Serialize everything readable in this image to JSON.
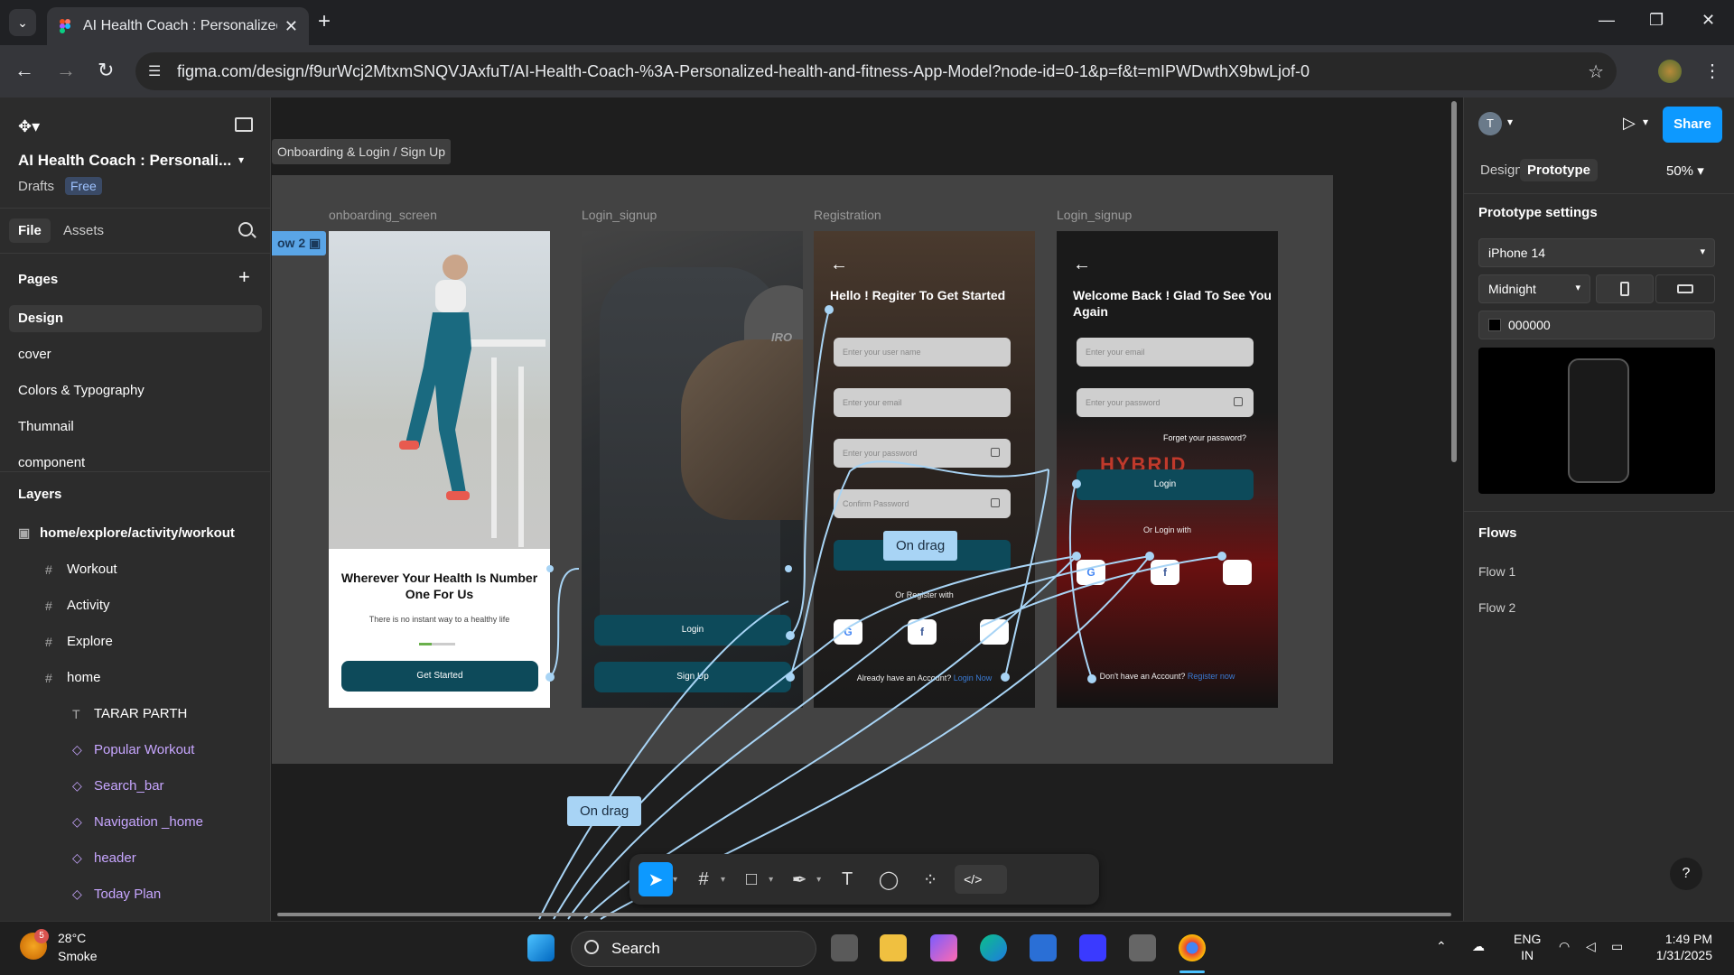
{
  "browser": {
    "tab_title": "AI Health Coach : Personalized",
    "url": "figma.com/design/f9urWcj2MtxmSNQVJAxfuT/AI-Health-Coach-%3A-Personalized-health-and-fitness-App-Model?node-id=0-1&p=f&t=mIPWDwthX9bwLjof-0"
  },
  "left": {
    "project_title": "AI Health Coach : Personali...",
    "drafts": "Drafts",
    "plan_badge": "Free",
    "tabs": [
      "File",
      "Assets"
    ],
    "pages_header": "Pages",
    "pages": [
      "Design",
      "cover",
      "Colors & Typography",
      "Thumnail",
      "component"
    ],
    "layers_header": "Layers",
    "layers": [
      {
        "name": "home/explore/activity/workout",
        "type": "section"
      },
      {
        "name": "Workout",
        "type": "frame"
      },
      {
        "name": "Activity",
        "type": "frame"
      },
      {
        "name": "Explore",
        "type": "frame"
      },
      {
        "name": "home",
        "type": "frame"
      },
      {
        "name": "TARAR PARTH",
        "type": "text"
      },
      {
        "name": "Popular Workout",
        "type": "component"
      },
      {
        "name": "Search_bar",
        "type": "component"
      },
      {
        "name": "Navigation _home",
        "type": "component"
      },
      {
        "name": "header",
        "type": "component"
      },
      {
        "name": "Today Plan",
        "type": "component"
      }
    ]
  },
  "canvas": {
    "section_label": "Onboarding & Login / Sign Up",
    "flow_tag": "ow 2",
    "frames": {
      "f1": {
        "label": "onboarding_screen",
        "title": "Wherever Your Health Is Number One For Us",
        "subtitle": "There is no instant way to a healthy life",
        "button": "Get Started"
      },
      "f2": {
        "label": "Login_signup",
        "login": "Login",
        "signup": "Sign Up",
        "brand": "IRO"
      },
      "f3": {
        "label": "Registration",
        "title": "Hello ! Regiter To Get Started",
        "username": "Enter your user name",
        "email": "Enter your email",
        "password": "Enter your password",
        "confirm": "Confirm Password",
        "or": "Or Register with",
        "footer": "Already have an Account?",
        "footer_link": "Login Now"
      },
      "f4": {
        "label": "Login_signup",
        "title": "Welcome Back ! Glad To See You Again",
        "email": "Enter your email",
        "password": "Enter your password",
        "forgot": "Forget your password?",
        "login": "Login",
        "or": "Or Login with",
        "footer": "Don't have an Account?",
        "footer_link": "Register now",
        "bg_text": "HYBRID"
      }
    },
    "ondrag_labels": [
      "On drag",
      "On drag"
    ]
  },
  "right": {
    "user_initial": "T",
    "share": "Share",
    "tabs": [
      "Design",
      "Prototype"
    ],
    "zoom": "50%",
    "proto_settings": "Prototype settings",
    "device": "iPhone 14",
    "model": "Midnight",
    "bg_hex": "000000",
    "flows_header": "Flows",
    "flows": [
      "Flow 1",
      "Flow 2"
    ],
    "help": "?"
  },
  "taskbar": {
    "temp": "28°C",
    "weather": "Smoke",
    "weather_badge": "5",
    "search": "Search",
    "lang1": "ENG",
    "lang2": "IN",
    "time": "1:49 PM",
    "date": "1/31/2025"
  },
  "colors": {
    "accent": "#0d99ff",
    "button_teal": "#0d4a5a",
    "connector": "#a8d4f5"
  }
}
